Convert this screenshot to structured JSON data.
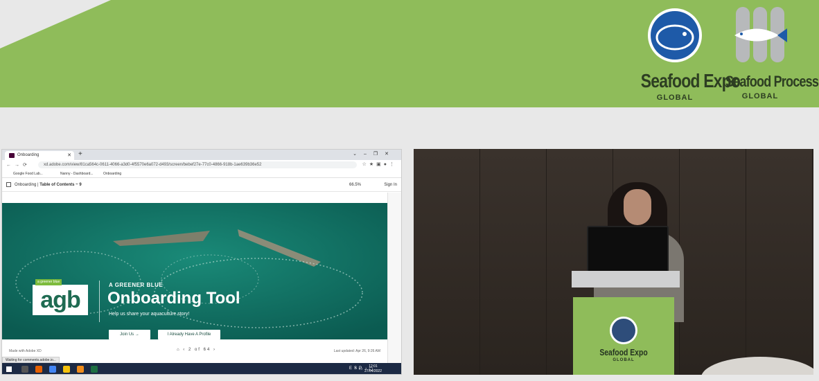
{
  "banner": {
    "expo": {
      "name": "Seafood Expo",
      "sub": "GLOBAL"
    },
    "processing": {
      "name": "Seafood Processing",
      "sub": "GLOBAL"
    },
    "color": "#8fbc5a"
  },
  "browser": {
    "tab_title": "Onboarding",
    "url": "xd.adobe.com/view/81ca564c-0611-4066-a3d0-4f5570e6a072-d493/screen/bebef27e-77c0-4866-918b-1ae639b36e52",
    "bookmarks": [
      "Google Food Lab...",
      "Nanny - Dashboard...",
      "Onboarding"
    ]
  },
  "xd": {
    "breadcrumb_root": "Onboarding",
    "breadcrumb_sep": "|",
    "breadcrumb_page": "Table of Contents ~ 9",
    "zoom": "66.5%",
    "sign_in": "Sign In",
    "made_with": "Made with Adobe XD",
    "pager": "2 of 64",
    "last_updated": "Last updated: Apr 26, 9:26 AM",
    "status": "Waiting for comments.adobe.io..."
  },
  "artboard": {
    "logo_tag": "a greener blue",
    "logo_text": "agb",
    "kicker": "A GREENER BLUE",
    "title": "Onboarding Tool",
    "subtitle": "Help us share your aquaculture story!",
    "join_label": "Join Us  →",
    "profile_label": "I Already Have A Profile"
  },
  "taskbar": {
    "lang": "ESP",
    "time": "12:01",
    "date": "27/04/2022"
  },
  "lectern": {
    "name": "Seafood Expo",
    "sub": "GLOBAL"
  }
}
